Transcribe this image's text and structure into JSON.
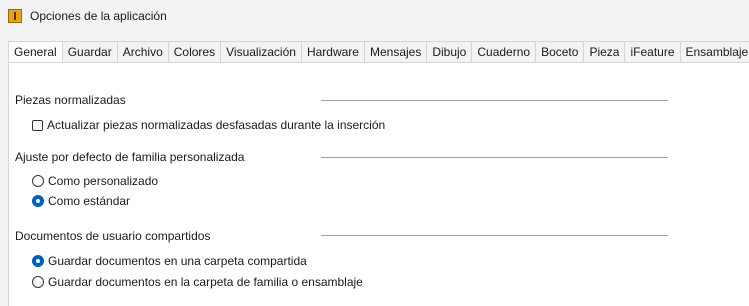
{
  "window": {
    "title": "Opciones de la aplicación"
  },
  "tabs": [
    {
      "label": "General",
      "active": true
    },
    {
      "label": "Guardar",
      "active": false
    },
    {
      "label": "Archivo",
      "active": false
    },
    {
      "label": "Colores",
      "active": false
    },
    {
      "label": "Visualización",
      "active": false
    },
    {
      "label": "Hardware",
      "active": false
    },
    {
      "label": "Mensajes",
      "active": false
    },
    {
      "label": "Dibujo",
      "active": false
    },
    {
      "label": "Cuaderno",
      "active": false
    },
    {
      "label": "Boceto",
      "active": false
    },
    {
      "label": "Pieza",
      "active": false
    },
    {
      "label": "iFeature",
      "active": false
    },
    {
      "label": "Ensamblaje",
      "active": false
    }
  ],
  "groups": {
    "standard_parts": {
      "title": "Piezas normalizadas",
      "update_checkbox": {
        "label": "Actualizar piezas normalizadas desfasadas durante la inserción",
        "checked": false
      }
    },
    "family_default": {
      "title": "Ajuste por defecto de familia personalizada",
      "options": [
        {
          "label": "Como personalizado",
          "selected": false
        },
        {
          "label": "Como estándar",
          "selected": true
        }
      ]
    },
    "shared_docs": {
      "title": "Documentos de usuario compartidos",
      "options": [
        {
          "label": "Guardar documentos en una carpeta compartida",
          "selected": true
        },
        {
          "label": "Guardar documentos en la carpeta de familia o ensamblaje",
          "selected": false
        }
      ]
    }
  },
  "colors": {
    "accent": "#005fb8",
    "window_bg": "#f3f3f3",
    "panel_bg": "#ffffff"
  }
}
